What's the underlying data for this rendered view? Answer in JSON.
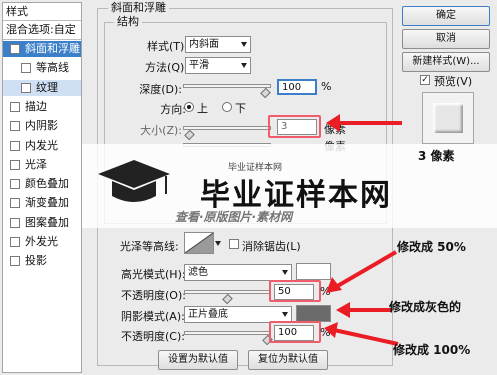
{
  "left_panel": {
    "header": "样式",
    "blend_options": "混合选项:自定",
    "items": [
      {
        "label": "斜面和浮雕",
        "checked": true,
        "selected": true
      },
      {
        "label": "等高线",
        "checked": false,
        "indent": true
      },
      {
        "label": "纹理",
        "checked": false,
        "indent": true,
        "highlight": true
      },
      {
        "label": "描边",
        "checked": false
      },
      {
        "label": "内阴影",
        "checked": false
      },
      {
        "label": "内发光",
        "checked": false
      },
      {
        "label": "光泽",
        "checked": false
      },
      {
        "label": "颜色叠加",
        "checked": false
      },
      {
        "label": "渐变叠加",
        "checked": false
      },
      {
        "label": "图案叠加",
        "checked": false
      },
      {
        "label": "外发光",
        "checked": false
      },
      {
        "label": "投影",
        "checked": false
      }
    ]
  },
  "bevel": {
    "group_title": "斜面和浮雕",
    "structure_title": "结构",
    "style_label": "样式(T):",
    "style_value": "内斜面",
    "method_label": "方法(Q):",
    "method_value": "平滑",
    "depth_label": "深度(D):",
    "depth_value": "100",
    "percent": "%",
    "direction_label": "方向:",
    "dir_up": "上",
    "dir_down": "下",
    "size_label": "大小(Z):",
    "size_value": "3",
    "size_unit": "像素",
    "soften_unit": "像素",
    "gloss_label": "光泽等高线:",
    "antialias_label": "消除锯齿(L)",
    "highlight_mode_label": "高光模式(H):",
    "highlight_mode_value": "滤色",
    "highlight_opacity_label": "不透明度(O):",
    "highlight_opacity_value": "50",
    "shadow_mode_label": "阴影模式(A):",
    "shadow_mode_value": "正片叠底",
    "shadow_opacity_label": "不透明度(C):",
    "shadow_opacity_value": "100",
    "make_default": "设置为默认值",
    "reset_default": "复位为默认值",
    "highlight_color": "#ffffff",
    "shadow_color": "#6b6b6b"
  },
  "right_panel": {
    "ok": "确定",
    "cancel": "取消",
    "new_style": "新建样式(W)...",
    "preview": "预览(V)"
  },
  "annotations": {
    "size_note": "3 像素",
    "opacity_note": "修改成 50%",
    "gray_note": "修改成灰色的",
    "opacity_100_note": "修改成 100%"
  },
  "watermark": {
    "main": "毕业证样本网",
    "small_top": "毕业证样本网",
    "small_line": "查看·原版图片·素材网"
  }
}
